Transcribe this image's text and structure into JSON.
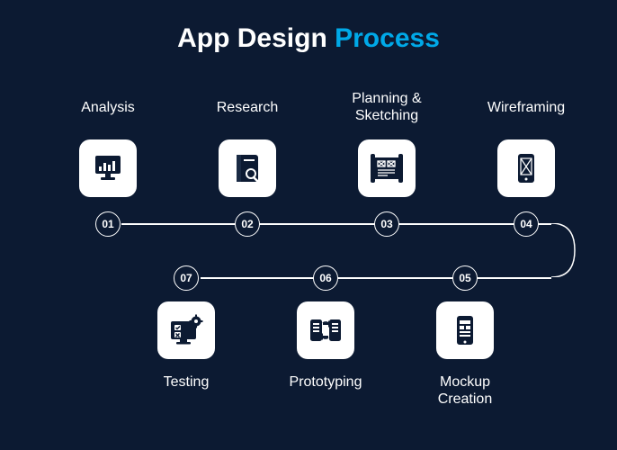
{
  "title": {
    "plain": "App Design ",
    "accent": "Process"
  },
  "steps": [
    {
      "num": "01",
      "label": "Analysis"
    },
    {
      "num": "02",
      "label": "Research"
    },
    {
      "num": "03",
      "label": "Planning & Sketching"
    },
    {
      "num": "04",
      "label": "Wireframing"
    },
    {
      "num": "05",
      "label": "Mockup Creation"
    },
    {
      "num": "06",
      "label": "Prototyping"
    },
    {
      "num": "07",
      "label": "Testing"
    }
  ]
}
